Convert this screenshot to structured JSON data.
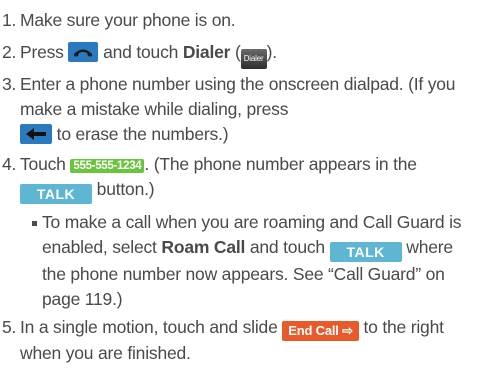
{
  "steps": [
    {
      "num": "1.",
      "text": "Make sure your phone is on."
    },
    {
      "num": "2.",
      "pre": "Press",
      "mid": "and touch",
      "bold": "Dialer",
      "open_paren": "(",
      "icon_label": "Dialer",
      "close": ")."
    },
    {
      "num": "3.",
      "text": "Enter a phone number using the onscreen dialpad. (If you make a mistake while dialing, press",
      "after": "to erase the numbers.)"
    },
    {
      "num": "4.",
      "pre": "Touch",
      "pill": "555-555-1234",
      "mid": ". (The phone number appears in the",
      "button": "TALK",
      "after": "button.)"
    },
    {
      "num": "5.",
      "pre": "In a single motion, touch and slide",
      "button": "End Call ⇨",
      "after": "to the right when you are finished."
    }
  ],
  "sub_bullet": {
    "pre": "To make a call when you are roaming and Call Guard is enabled, select",
    "bold": "Roam Call",
    "mid": "and touch",
    "button": "TALK",
    "after": "where the phone number now appears. See “Call Guard” on page 119.)"
  },
  "icons": {
    "phone": "phone-handset-icon",
    "dialer": "dialer-icon",
    "delete": "backspace-arrow-icon"
  },
  "colors": {
    "text": "#4a4a4a",
    "blue_button": "#2a7abf",
    "talk_button": "#5fb6d2",
    "number_pill": "#6bc43d",
    "end_call": "#e95a2b"
  }
}
